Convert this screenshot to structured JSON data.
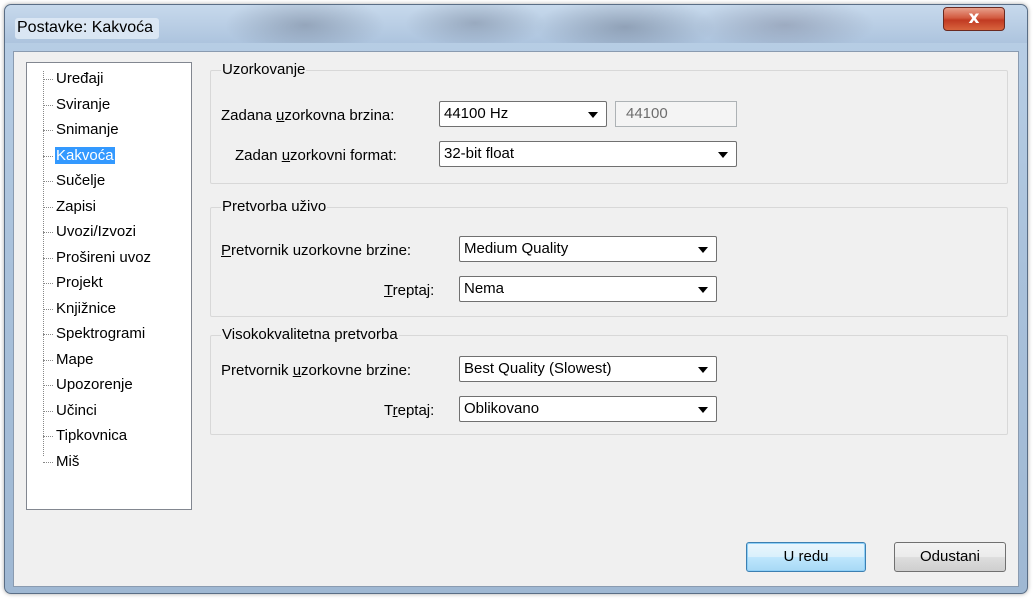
{
  "window": {
    "title": "Postavke: Kakvoća",
    "close_label": "x"
  },
  "sidebar": {
    "items": [
      {
        "label": "Uređaji"
      },
      {
        "label": "Sviranje"
      },
      {
        "label": "Snimanje"
      },
      {
        "label": "Kakvoća",
        "selected": true
      },
      {
        "label": "Sučelje"
      },
      {
        "label": "Zapisi"
      },
      {
        "label": "Uvozi/Izvozi"
      },
      {
        "label": "Prošireni uvoz"
      },
      {
        "label": "Projekt"
      },
      {
        "label": "Knjižnice"
      },
      {
        "label": "Spektrogrami"
      },
      {
        "label": "Mape"
      },
      {
        "label": "Upozorenje"
      },
      {
        "label": "Učinci"
      },
      {
        "label": "Tipkovnica"
      },
      {
        "label": "Miš"
      }
    ]
  },
  "sampling": {
    "title": "Uzorkovanje",
    "rate_label_pre": "Zadana ",
    "rate_label_u": "u",
    "rate_label_post": "zorkovna brzina:",
    "rate_value": "44100 Hz",
    "rate_text": "44100",
    "format_label_pre": "Zadan ",
    "format_label_u": "u",
    "format_label_post": "zorkovni format:",
    "format_value": "32-bit float"
  },
  "realtime": {
    "title": "Pretvorba uživo",
    "converter_label_u": "P",
    "converter_label_post": "retvornik uzorkovne brzine:",
    "converter_value": "Medium Quality",
    "dither_label_u": "T",
    "dither_label_post": "reptaj:",
    "dither_value": "Nema"
  },
  "hq": {
    "title": "Visokokvalitetna pretvorba",
    "converter_label_pre": "Pretvornik ",
    "converter_label_u": "u",
    "converter_label_post": "zorkovne brzine:",
    "converter_value": "Best Quality (Slowest)",
    "dither_label_pre": "T",
    "dither_label_u": "r",
    "dither_label_post": "eptaj:",
    "dither_value": "Oblikovano"
  },
  "buttons": {
    "ok": "U redu",
    "cancel": "Odustani"
  }
}
